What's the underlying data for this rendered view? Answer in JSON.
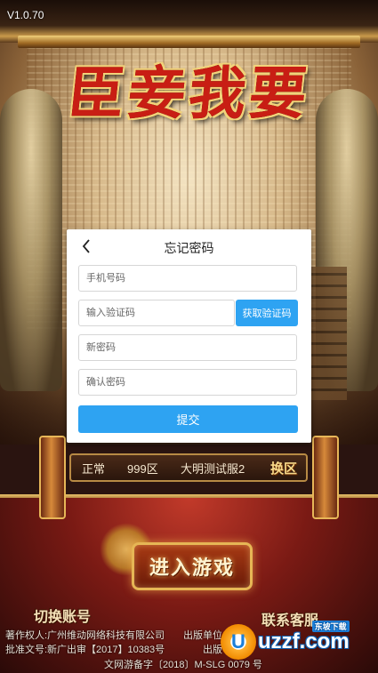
{
  "version": "V1.0.70",
  "logo": {
    "text": "臣妾我要"
  },
  "dialog": {
    "title": "忘记密码",
    "phone_placeholder": "手机号码",
    "code_placeholder": "输入验证码",
    "get_code_label": "获取验证码",
    "new_password_placeholder": "新密码",
    "confirm_password_placeholder": "确认密码",
    "submit_label": "提交"
  },
  "server": {
    "status": "正常",
    "zone": "999区",
    "name": "大明测试服2",
    "switch_label": "换区"
  },
  "enter_game_label": "进入游戏",
  "switch_account_label": "切换账号",
  "customer_service_label": "联系客服",
  "footer": {
    "line1": "著作权人:广州维动网络科技有限公司",
    "line2": "批准文号:新广出审【2017】10383号",
    "line3": "文网游备字〔2018〕M-SLG 0079 号",
    "line1_right": "出版单位",
    "line2_right": "出版"
  },
  "watermark": {
    "logo": "uzzf.com",
    "sub": "东坡下载",
    "circle_letter": "U"
  },
  "colors": {
    "accent_blue": "#2ea3f2",
    "logo_red": "#c81e14",
    "gold": "#e6b655"
  }
}
